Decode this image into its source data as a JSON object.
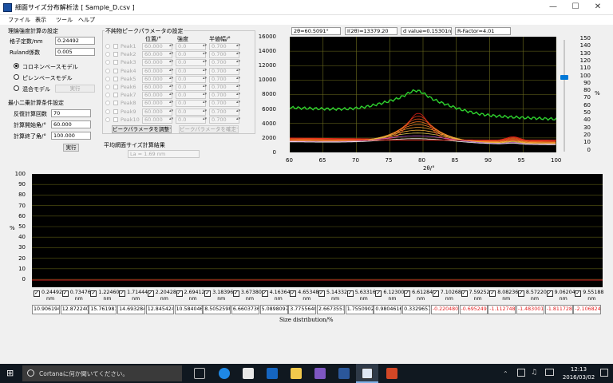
{
  "window": {
    "title": "細面サイズ分布解析法 [ Sample_D.csv ]"
  },
  "menu": [
    "ファイル",
    "表示",
    "ツール",
    "ヘルプ"
  ],
  "theory": {
    "title": "理論強度計算の設定",
    "lattice_label": "格子定数/nm",
    "lattice_value": "0.24492",
    "ruland_label": "Ruland係数",
    "ruland_value": "0.005",
    "models": [
      "コロネンベースモデル",
      "ピレンベースモデル",
      "混合モデル"
    ],
    "selected_model": 0,
    "run_label": "実行"
  },
  "lsq": {
    "title": "最小二乗計算条件設定",
    "iter_label": "反復計算回数",
    "iter_value": "70",
    "start_label": "計算開始角/°",
    "start_value": "60.000",
    "end_label": "計算終了角/°",
    "end_value": "100.000",
    "run_label": "実行"
  },
  "impurity": {
    "title": "不純物ピークパラメータの設定",
    "col_pos": "位置/°",
    "col_int": "強度",
    "col_fwhm": "半値幅/°",
    "rows": [
      {
        "label": "Peak1",
        "pos": "60.000",
        "int": "0.0",
        "fwhm": "0.700"
      },
      {
        "label": "Peak2",
        "pos": "60.000",
        "int": "0.0",
        "fwhm": "0.700"
      },
      {
        "label": "Peak3",
        "pos": "60.000",
        "int": "0.0",
        "fwhm": "0.700"
      },
      {
        "label": "Peak4",
        "pos": "60.000",
        "int": "0.0",
        "fwhm": "0.700"
      },
      {
        "label": "Peak5",
        "pos": "60.000",
        "int": "0.0",
        "fwhm": "0.700"
      },
      {
        "label": "Peak6",
        "pos": "60.000",
        "int": "0.0",
        "fwhm": "0.700"
      },
      {
        "label": "Peak7",
        "pos": "60.000",
        "int": "0.0",
        "fwhm": "0.700"
      },
      {
        "label": "Peak8",
        "pos": "60.000",
        "int": "0.0",
        "fwhm": "0.700"
      },
      {
        "label": "Peak9",
        "pos": "60.000",
        "int": "0.0",
        "fwhm": "0.700"
      },
      {
        "label": "Peak10",
        "pos": "60.000",
        "int": "0.0",
        "fwhm": "0.700"
      }
    ],
    "adjust_label": "ピークパラメータを調整する",
    "confirm_label": "ピークパラメータを確定する"
  },
  "avgsize": {
    "title": "平均網面サイズ計算結果",
    "value": "La = 1.69 nm"
  },
  "readout": {
    "two_theta": "2θ=60.5091°",
    "intensity": "I(2θ)=13379.20",
    "dvalue": "d value=0.15301nm",
    "rfactor": "R-Factor=4.01"
  },
  "top_chart": {
    "y_ticks": [
      "16000",
      "14000",
      "12000",
      "10000",
      "8000",
      "6000",
      "4000",
      "2000",
      "0"
    ],
    "x_ticks": [
      "60",
      "65",
      "70",
      "75",
      "80",
      "85",
      "90",
      "95",
      "100"
    ],
    "xlabel": "2θ/°",
    "right_ticks": [
      "150",
      "140",
      "130",
      "120",
      "110",
      "100",
      "90",
      "80",
      "70",
      "60",
      "50",
      "40",
      "30",
      "20",
      "10",
      "0"
    ],
    "right_label": "%",
    "slider_value": 100,
    "colors": {
      "bg": "#000000",
      "green": "#2ed22e",
      "red": "#e03020",
      "grid": "#6e6e1e"
    }
  },
  "bottom_chart": {
    "y_ticks": [
      "100",
      "90",
      "80",
      "70",
      "60",
      "50",
      "40",
      "30",
      "20",
      "10",
      "0"
    ],
    "ylabel": "%",
    "xlabel": "Size distribution/%"
  },
  "sizes": [
    {
      "size": "0.24492",
      "unit": "nm",
      "value": "10.9061948"
    },
    {
      "size": "0.73476",
      "unit": "nm",
      "value": "12.8722404"
    },
    {
      "size": "1.22460",
      "unit": "nm",
      "value": "15.7619815"
    },
    {
      "size": "1.71444",
      "unit": "nm",
      "value": "14.6932848"
    },
    {
      "size": "2.20428",
      "unit": "nm",
      "value": "12.8454248"
    },
    {
      "size": "2.69412",
      "unit": "nm",
      "value": "10.5840466"
    },
    {
      "size": "3.18396",
      "unit": "nm",
      "value": "8.50525983"
    },
    {
      "size": "3.67380",
      "unit": "nm",
      "value": "6.66037362"
    },
    {
      "size": "4.16364",
      "unit": "nm",
      "value": "5.08980975"
    },
    {
      "size": "4.65348",
      "unit": "nm",
      "value": "3.77556408"
    },
    {
      "size": "5.14332",
      "unit": "nm",
      "value": "2.66735517"
    },
    {
      "size": "5.63316",
      "unit": "nm",
      "value": "1.75509026"
    },
    {
      "size": "6.12300",
      "unit": "nm",
      "value": "0.98046166"
    },
    {
      "size": "6.61284",
      "unit": "nm",
      "value": "0.33296571"
    },
    {
      "size": "7.10268",
      "unit": "nm",
      "value": "-0.2204803"
    },
    {
      "size": "7.59252",
      "unit": "nm",
      "value": "-0.6952492"
    },
    {
      "size": "8.08236",
      "unit": "nm",
      "value": "-1.1127482"
    },
    {
      "size": "8.57220",
      "unit": "nm",
      "value": "-1.4830015"
    },
    {
      "size": "9.06204",
      "unit": "nm",
      "value": "-1.8117282"
    },
    {
      "size": "9.55188",
      "unit": "nm",
      "value": "-2.1068248"
    }
  ],
  "taskbar": {
    "search_placeholder": "Cortanaに何か聞いてください。",
    "time": "12:13",
    "date": "2016/03/02"
  }
}
